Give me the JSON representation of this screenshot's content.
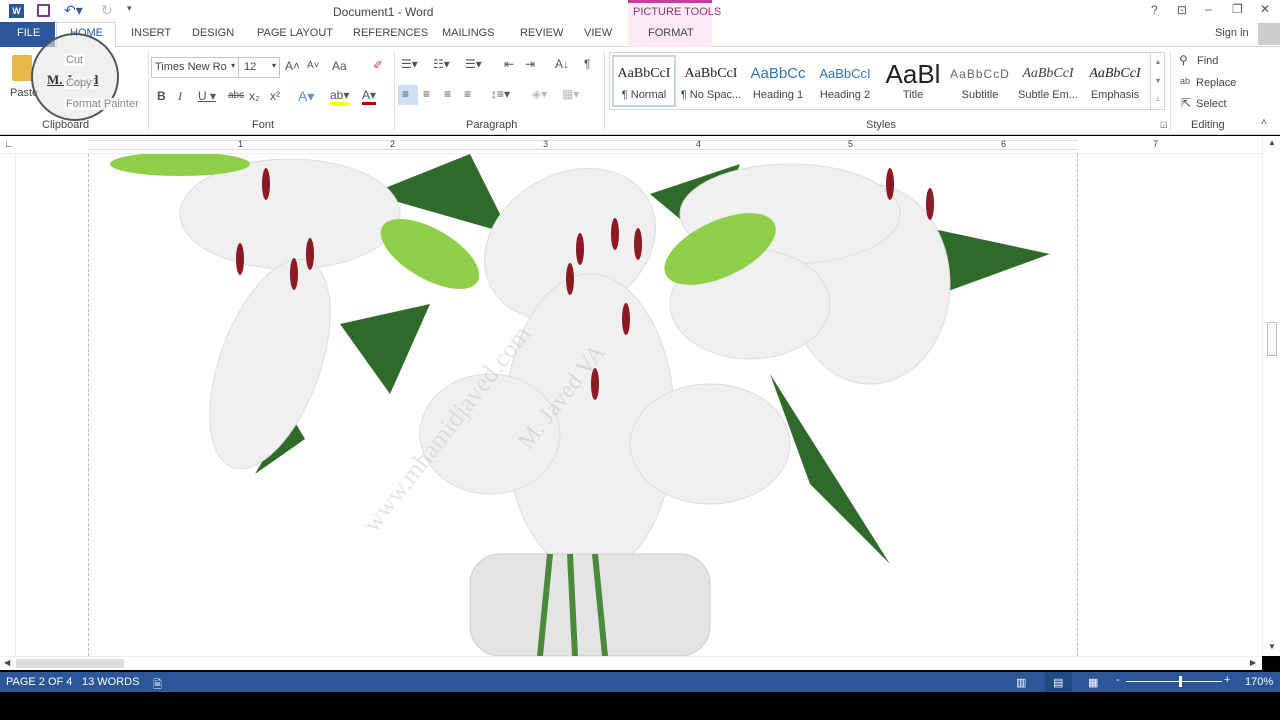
{
  "title": "Document1 - Word",
  "context_tab_group": "PICTURE TOOLS",
  "sign_in": "Sign in",
  "tabs": [
    "FILE",
    "HOME",
    "INSERT",
    "DESIGN",
    "PAGE LAYOUT",
    "REFERENCES",
    "MAILINGS",
    "REVIEW",
    "VIEW",
    "FORMAT"
  ],
  "clipboard": {
    "paste": "Paste",
    "cut": "Cut",
    "copy": "Copy",
    "format_painter": "Format Painter",
    "label": "Clipboard"
  },
  "font": {
    "name": "Times New Ro",
    "size": "12",
    "label": "Font",
    "case": "Aa"
  },
  "paragraph": {
    "label": "Paragraph"
  },
  "styles": {
    "label": "Styles",
    "items": [
      {
        "sample": "AaBbCcI",
        "name": "¶ Normal"
      },
      {
        "sample": "AaBbCcI",
        "name": "¶ No Spac..."
      },
      {
        "sample": "AaBbCc",
        "name": "Heading 1"
      },
      {
        "sample": "AaBbCcI",
        "name": "Heading 2"
      },
      {
        "sample": "AaBl",
        "name": "Title"
      },
      {
        "sample": "AaBbCcD",
        "name": "Subtitle"
      },
      {
        "sample": "AaBbCcI",
        "name": "Subtle Em..."
      },
      {
        "sample": "AaBbCcI",
        "name": "Emphasis"
      }
    ]
  },
  "editing": {
    "label": "Editing",
    "find": "Find",
    "replace": "Replace",
    "select": "Select"
  },
  "ruler": [
    "1",
    "2",
    "3",
    "4",
    "5",
    "6",
    "7"
  ],
  "watermark": {
    "stamp": "M. Javed",
    "diag1": "www.mhamidjaved.com",
    "diag2": "M. Javed VA"
  },
  "status": {
    "page": "PAGE 2 OF 4",
    "words": "13 WORDS",
    "zoom": "170%"
  },
  "colors": {
    "accent": "#2b579a",
    "picture_tools": "#c6409a"
  }
}
